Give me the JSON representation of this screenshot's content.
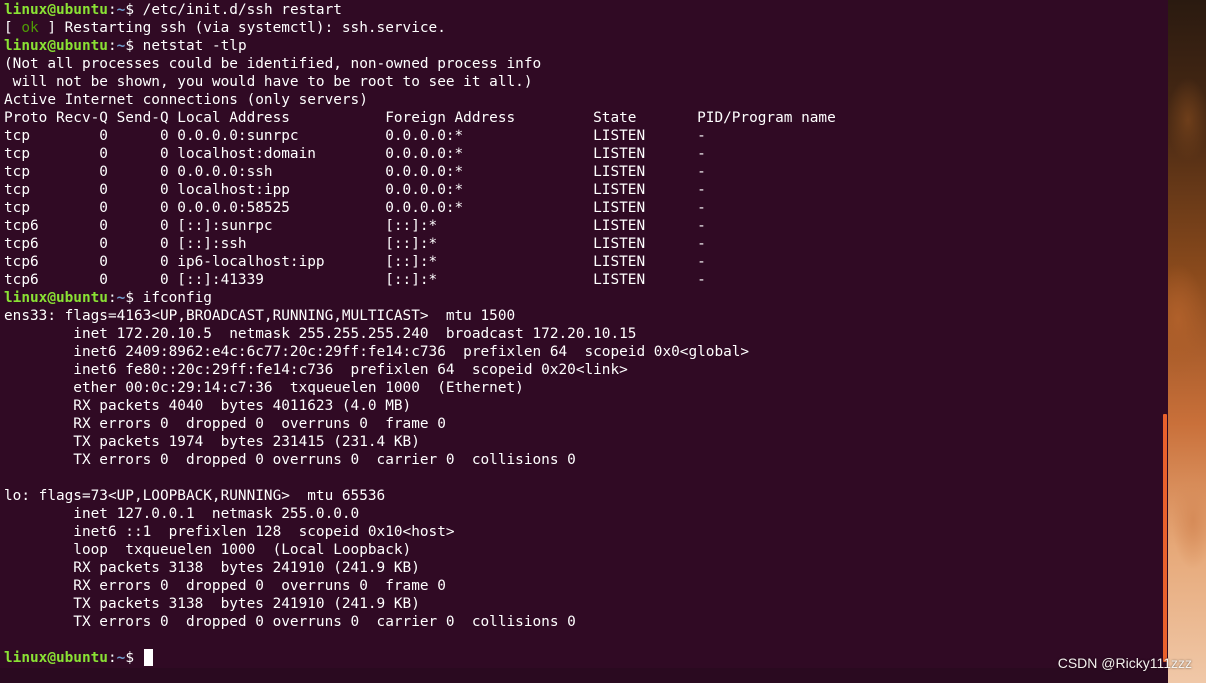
{
  "terminal": {
    "prompt": {
      "user": "linux@ubuntu",
      "path": "~",
      "symbol": "$"
    },
    "cmd1": "/etc/init.d/ssh restart",
    "restart": {
      "open": "[ ",
      "ok": "ok",
      "text": " ] Restarting ssh (via systemctl): ssh.service."
    },
    "cmd2": "netstat -tlp",
    "netstat_notice": [
      "(Not all processes could be identified, non-owned process info",
      " will not be shown, you would have to be root to see it all.)",
      "Active Internet connections (only servers)"
    ],
    "netstat_header": "Proto Recv-Q Send-Q Local Address           Foreign Address         State       PID/Program name",
    "netstat_rows": [
      "tcp        0      0 0.0.0.0:sunrpc          0.0.0.0:*               LISTEN      -",
      "tcp        0      0 localhost:domain        0.0.0.0:*               LISTEN      -",
      "tcp        0      0 0.0.0.0:ssh             0.0.0.0:*               LISTEN      -",
      "tcp        0      0 localhost:ipp           0.0.0.0:*               LISTEN      -",
      "tcp        0      0 0.0.0.0:58525           0.0.0.0:*               LISTEN      -",
      "tcp6       0      0 [::]:sunrpc             [::]:*                  LISTEN      -",
      "tcp6       0      0 [::]:ssh                [::]:*                  LISTEN      -",
      "tcp6       0      0 ip6-localhost:ipp       [::]:*                  LISTEN      -",
      "tcp6       0      0 [::]:41339              [::]:*                  LISTEN      -"
    ],
    "cmd3": "ifconfig",
    "ifconfig_ens33": [
      "ens33: flags=4163<UP,BROADCAST,RUNNING,MULTICAST>  mtu 1500",
      "        inet 172.20.10.5  netmask 255.255.255.240  broadcast 172.20.10.15",
      "        inet6 2409:8962:e4c:6c77:20c:29ff:fe14:c736  prefixlen 64  scopeid 0x0<global>",
      "        inet6 fe80::20c:29ff:fe14:c736  prefixlen 64  scopeid 0x20<link>",
      "        ether 00:0c:29:14:c7:36  txqueuelen 1000  (Ethernet)",
      "        RX packets 4040  bytes 4011623 (4.0 MB)",
      "        RX errors 0  dropped 0  overruns 0  frame 0",
      "        TX packets 1974  bytes 231415 (231.4 KB)",
      "        TX errors 0  dropped 0 overruns 0  carrier 0  collisions 0"
    ],
    "ifconfig_lo": [
      "lo: flags=73<UP,LOOPBACK,RUNNING>  mtu 65536",
      "        inet 127.0.0.1  netmask 255.0.0.0",
      "        inet6 ::1  prefixlen 128  scopeid 0x10<host>",
      "        loop  txqueuelen 1000  (Local Loopback)",
      "        RX packets 3138  bytes 241910 (241.9 KB)",
      "        RX errors 0  dropped 0  overruns 0  frame 0",
      "        TX packets 3138  bytes 241910 (241.9 KB)",
      "        TX errors 0  dropped 0 overruns 0  carrier 0  collisions 0"
    ]
  },
  "watermark": "CSDN @Ricky111zzz",
  "colors": {
    "background": "#300a24",
    "prompt_user": "#8ae234",
    "prompt_path": "#729fcf",
    "ok": "#4e9a06",
    "scrollbar": "#e9612c"
  }
}
